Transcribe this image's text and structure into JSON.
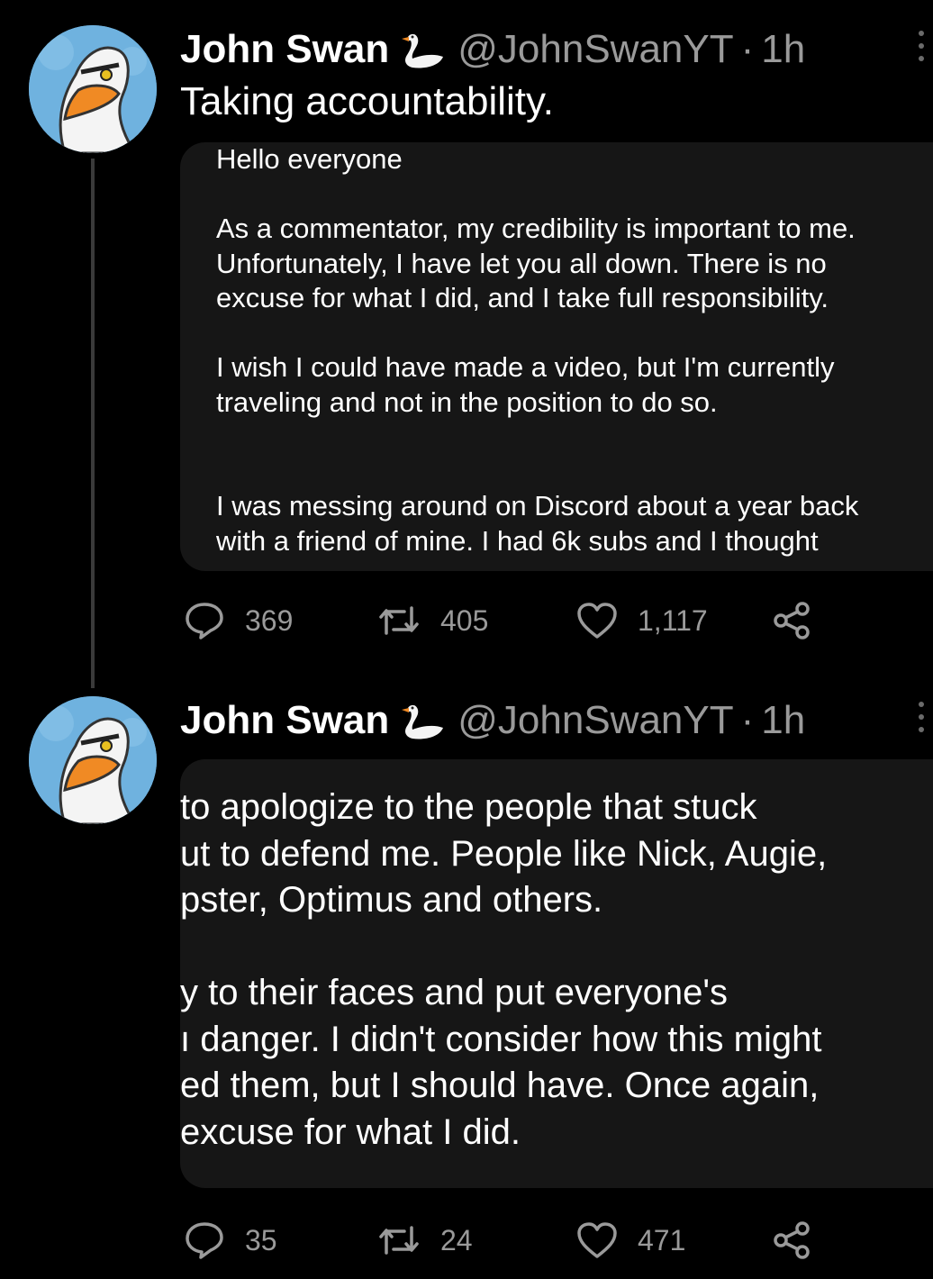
{
  "tweets": [
    {
      "display_name": "John Swan",
      "handle": "@JohnSwanYT",
      "separator": "·",
      "time": "1h",
      "text": "Taking accountability.",
      "card_paragraphs": [
        "Hello everyone",
        "As a commentator, my credibility is important to me.",
        "Unfortunately, I have let you all down. There is no",
        "excuse for what I did, and I take full responsibility.",
        "I wish I could have made a video, but I'm currently",
        "traveling and not in the position to do so.",
        "I was messing around on Discord about a year back",
        "with a friend of mine. I had 6k subs and I thought"
      ],
      "actions": {
        "replies": "369",
        "retweets": "405",
        "likes": "1,117"
      }
    },
    {
      "display_name": "John Swan",
      "handle": "@JohnSwanYT",
      "separator": "·",
      "time": "1h",
      "card_lines": [
        "to apologize to the people that stuck",
        "ut to defend me. People like Nick, Augie,",
        "pster, Optimus and others.",
        "y to their faces and put everyone's",
        "ı danger. I didn't consider how this might",
        "ed them, but I should have. Once again,",
        "excuse for what I did."
      ],
      "actions": {
        "replies": "35",
        "retweets": "24",
        "likes": "471"
      }
    }
  ],
  "icons": [
    "swan-icon",
    "reply-icon",
    "retweet-icon",
    "like-icon",
    "share-icon",
    "more-icon"
  ],
  "colors": {
    "background": "#000000",
    "card": "#161616",
    "muted_text": "#9a9a9a",
    "avatar_sky": "#6fb2df"
  }
}
